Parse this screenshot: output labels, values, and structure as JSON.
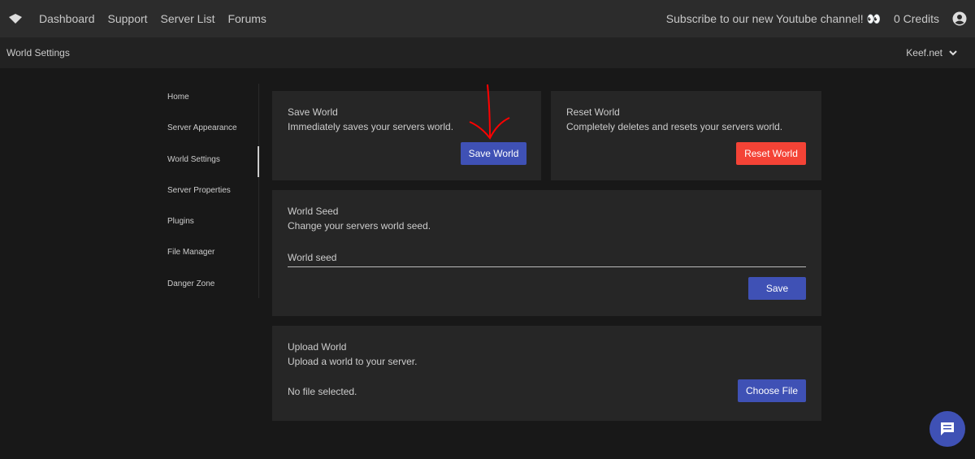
{
  "topbar": {
    "nav": [
      "Dashboard",
      "Support",
      "Server List",
      "Forums"
    ],
    "announcement": "Subscribe to our new Youtube channel! 👀",
    "credits": "0 Credits"
  },
  "subbar": {
    "title": "World Settings",
    "server": "Keef.net"
  },
  "sidebar": {
    "items": [
      "Home",
      "Server Appearance",
      "World Settings",
      "Server Properties",
      "Plugins",
      "File Manager",
      "Danger Zone"
    ],
    "active": "World Settings"
  },
  "save_world": {
    "title": "Save World",
    "desc": "Immediately saves your servers world.",
    "button": "Save World"
  },
  "reset_world": {
    "title": "Reset World",
    "desc": "Completely deletes and resets your servers world.",
    "button": "Reset World"
  },
  "world_seed": {
    "title": "World Seed",
    "desc": "Change your servers world seed.",
    "placeholder": "World seed",
    "button": "Save"
  },
  "upload_world": {
    "title": "Upload World",
    "desc": "Upload a world to your server.",
    "status": "No file selected.",
    "button": "Choose File"
  },
  "colors": {
    "primary": "#3f51b5",
    "danger": "#f44336",
    "annotation": "#ff0000"
  }
}
